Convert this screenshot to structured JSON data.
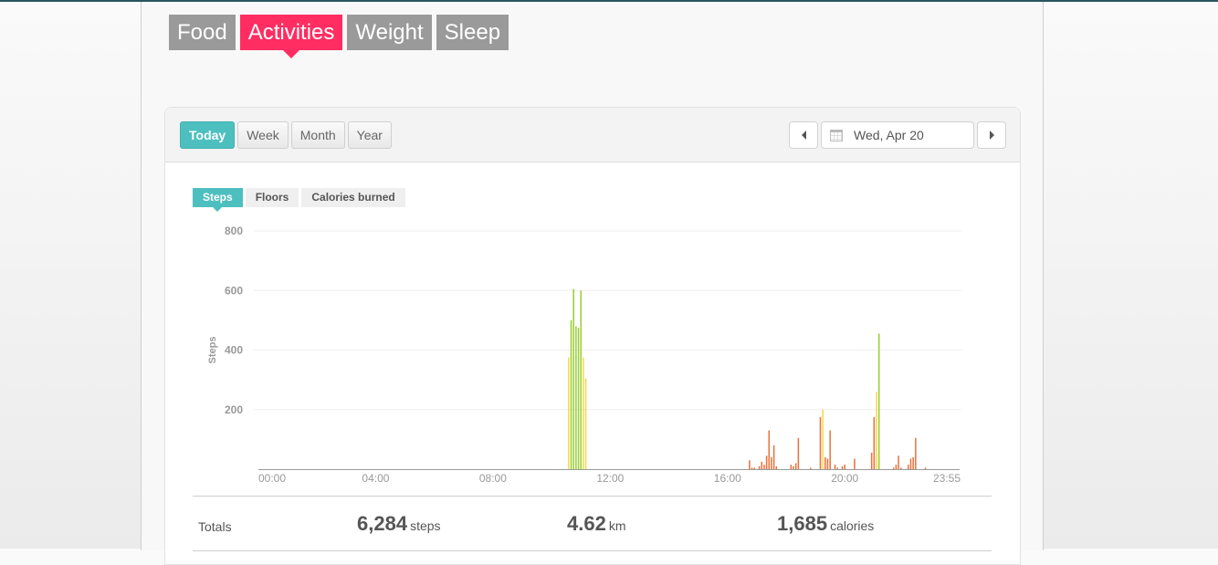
{
  "main_tabs": [
    {
      "label": "Food",
      "active": false
    },
    {
      "label": "Activities",
      "active": true
    },
    {
      "label": "Weight",
      "active": false
    },
    {
      "label": "Sleep",
      "active": false
    }
  ],
  "range_buttons": [
    {
      "label": "Today",
      "active": true
    },
    {
      "label": "Week",
      "active": false
    },
    {
      "label": "Month",
      "active": false
    },
    {
      "label": "Year",
      "active": false
    }
  ],
  "date_nav": {
    "prev_icon": "triangle-left-icon",
    "calendar_icon": "calendar-icon",
    "date": "Wed, Apr 20",
    "next_icon": "triangle-right-icon"
  },
  "metric_tabs": [
    {
      "label": "Steps",
      "active": true
    },
    {
      "label": "Floors",
      "active": false
    },
    {
      "label": "Calories burned",
      "active": false
    }
  ],
  "colors": {
    "accent_pink": "#ff2d62",
    "accent_teal": "#4dbfbf",
    "bar_low": "#e8703a",
    "bar_mid": "#f2d94a",
    "bar_high": "#9acd32"
  },
  "chart_data": {
    "type": "bar",
    "title": "",
    "xlabel": "",
    "ylabel": "Steps",
    "ylim": [
      0,
      800
    ],
    "yticks": [
      200,
      400,
      600,
      800
    ],
    "xlim_minutes": [
      0,
      1435
    ],
    "xtick_labels": [
      "00:00",
      "04:00",
      "08:00",
      "12:00",
      "16:00",
      "20:00",
      "23:55"
    ],
    "xtick_minutes": [
      0,
      240,
      480,
      720,
      960,
      1200,
      1435
    ],
    "interval_minutes": 5,
    "grid": true,
    "series": [
      {
        "name": "Steps",
        "points": [
          {
            "time": "10:35",
            "value": 375,
            "level": "mid"
          },
          {
            "time": "10:40",
            "value": 500,
            "level": "high"
          },
          {
            "time": "10:45",
            "value": 605,
            "level": "high"
          },
          {
            "time": "10:50",
            "value": 480,
            "level": "high"
          },
          {
            "time": "10:55",
            "value": 475,
            "level": "high"
          },
          {
            "time": "11:00",
            "value": 600,
            "level": "high"
          },
          {
            "time": "11:05",
            "value": 375,
            "level": "mid"
          },
          {
            "time": "11:10",
            "value": 305,
            "level": "mid"
          },
          {
            "time": "16:45",
            "value": 30,
            "level": "low"
          },
          {
            "time": "16:50",
            "value": 5,
            "level": "low"
          },
          {
            "time": "16:55",
            "value": 5,
            "level": "low"
          },
          {
            "time": "17:05",
            "value": 10,
            "level": "low"
          },
          {
            "time": "17:10",
            "value": 25,
            "level": "low"
          },
          {
            "time": "17:15",
            "value": 15,
            "level": "low"
          },
          {
            "time": "17:20",
            "value": 45,
            "level": "low"
          },
          {
            "time": "17:25",
            "value": 130,
            "level": "low"
          },
          {
            "time": "17:30",
            "value": 40,
            "level": "low"
          },
          {
            "time": "17:35",
            "value": 80,
            "level": "low"
          },
          {
            "time": "17:40",
            "value": 10,
            "level": "low"
          },
          {
            "time": "18:10",
            "value": 15,
            "level": "low"
          },
          {
            "time": "18:15",
            "value": 10,
            "level": "low"
          },
          {
            "time": "18:20",
            "value": 20,
            "level": "low"
          },
          {
            "time": "18:25",
            "value": 105,
            "level": "low"
          },
          {
            "time": "18:50",
            "value": 5,
            "level": "low"
          },
          {
            "time": "19:10",
            "value": 175,
            "level": "low"
          },
          {
            "time": "19:15",
            "value": 200,
            "level": "mid"
          },
          {
            "time": "19:20",
            "value": 40,
            "level": "low"
          },
          {
            "time": "19:25",
            "value": 35,
            "level": "low"
          },
          {
            "time": "19:30",
            "value": 130,
            "level": "low"
          },
          {
            "time": "19:40",
            "value": 15,
            "level": "low"
          },
          {
            "time": "19:45",
            "value": 5,
            "level": "low"
          },
          {
            "time": "19:55",
            "value": 10,
            "level": "low"
          },
          {
            "time": "20:00",
            "value": 15,
            "level": "low"
          },
          {
            "time": "20:20",
            "value": 35,
            "level": "low"
          },
          {
            "time": "20:55",
            "value": 55,
            "level": "low"
          },
          {
            "time": "21:00",
            "value": 175,
            "level": "low"
          },
          {
            "time": "21:05",
            "value": 260,
            "level": "mid"
          },
          {
            "time": "21:10",
            "value": 455,
            "level": "high"
          },
          {
            "time": "21:40",
            "value": 5,
            "level": "low"
          },
          {
            "time": "21:45",
            "value": 15,
            "level": "low"
          },
          {
            "time": "21:50",
            "value": 45,
            "level": "low"
          },
          {
            "time": "21:55",
            "value": 5,
            "level": "low"
          },
          {
            "time": "22:10",
            "value": 15,
            "level": "low"
          },
          {
            "time": "22:15",
            "value": 35,
            "level": "low"
          },
          {
            "time": "22:20",
            "value": 40,
            "level": "low"
          },
          {
            "time": "22:25",
            "value": 105,
            "level": "low"
          },
          {
            "time": "22:45",
            "value": 5,
            "level": "low"
          }
        ]
      }
    ]
  },
  "totals": {
    "label": "Totals",
    "items": [
      {
        "value": "6,284",
        "unit": "steps"
      },
      {
        "value": "4.62",
        "unit": "km"
      },
      {
        "value": "1,685",
        "unit": "calories"
      }
    ]
  }
}
